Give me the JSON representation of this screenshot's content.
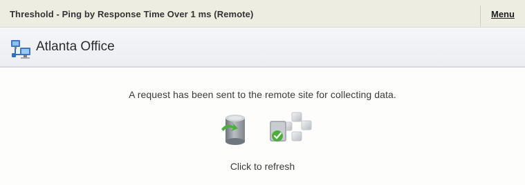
{
  "title_bar": {
    "title": "Threshold - Ping by Response Time Over 1 ms (Remote)",
    "menu_label": "Menu"
  },
  "site": {
    "name": "Atlanta Office",
    "icon": "network-computers-icon"
  },
  "status": {
    "message": "A request has been sent to the remote site for collecting data.",
    "refresh_label": "Click to refresh",
    "icons": [
      "database-refresh-icon",
      "remote-servers-check-icon"
    ]
  },
  "colors": {
    "title_bar_bg": "#eeede2",
    "header_bg": "#eceef2",
    "accent_green": "#4caf3c",
    "db_gray": "#8f969c"
  }
}
